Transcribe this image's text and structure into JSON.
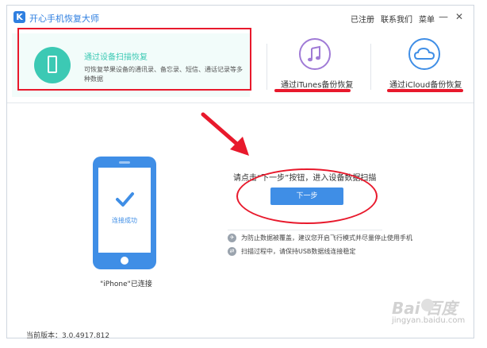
{
  "app": {
    "logo_letter": "K",
    "title": "开心手机恢复大师"
  },
  "titlebar": {
    "registered": "已注册",
    "contact": "联系我们",
    "menu": "菜单",
    "minimize": "—",
    "close": "✕"
  },
  "tabs": {
    "device_scan": {
      "title": "通过设备扫描恢复",
      "description": "可恢复苹果设备的通讯录、备忘录、短信、通话记录等多种数据"
    },
    "itunes": {
      "label": "通过iTunes备份恢复",
      "icon": "music-note-icon"
    },
    "icloud": {
      "label": "通过iCloud备份恢复",
      "icon": "cloud-icon"
    }
  },
  "device": {
    "connect_status": "连接成功",
    "name_status": "\"iPhone\"已连接"
  },
  "main": {
    "prompt": "请点击“下一步”按钮，进入设备数据扫描",
    "next_button": "下一步",
    "tips": [
      {
        "icon": "airplane-icon",
        "text": "为防止数据被覆盖，建议您开启飞行模式并尽量停止使用手机"
      },
      {
        "icon": "usb-icon",
        "text": "扫描过程中，请保持USB数据线连接稳定"
      }
    ]
  },
  "footer": {
    "version": "当前版本：3.0.4917.812"
  },
  "watermark": {
    "brand": "Bai  百度",
    "sub": "jingyan.baidu.com"
  },
  "colors": {
    "accent_blue": "#3f8ee6",
    "teal": "#3cc9b4",
    "purple": "#a07bd6",
    "annotation_red": "#e8192c"
  }
}
